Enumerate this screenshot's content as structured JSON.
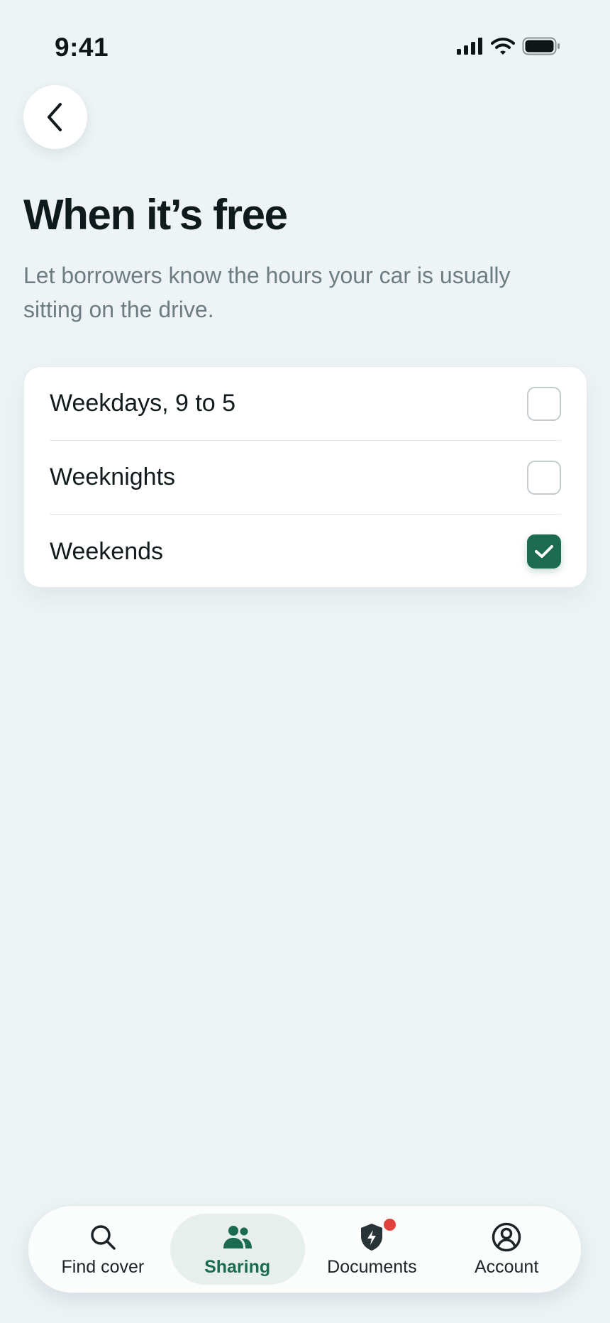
{
  "status_bar": {
    "time": "9:41"
  },
  "header": {
    "title": "When it’s free",
    "subtitle": "Let borrowers know the hours your car is usually sitting on the drive."
  },
  "options": [
    {
      "label": "Weekdays, 9 to 5",
      "checked": false
    },
    {
      "label": "Weeknights",
      "checked": false
    },
    {
      "label": "Weekends",
      "checked": true
    }
  ],
  "tabs": [
    {
      "label": "Find cover",
      "icon": "search-icon",
      "active": false,
      "badge": false
    },
    {
      "label": "Sharing",
      "icon": "people-icon",
      "active": true,
      "badge": false
    },
    {
      "label": "Documents",
      "icon": "shield-bolt-icon",
      "active": false,
      "badge": true
    },
    {
      "label": "Account",
      "icon": "user-circle-icon",
      "active": false,
      "badge": false
    }
  ],
  "colors": {
    "accent": "#1a6b50",
    "background": "#eef4f6",
    "badge": "#e0413a"
  }
}
